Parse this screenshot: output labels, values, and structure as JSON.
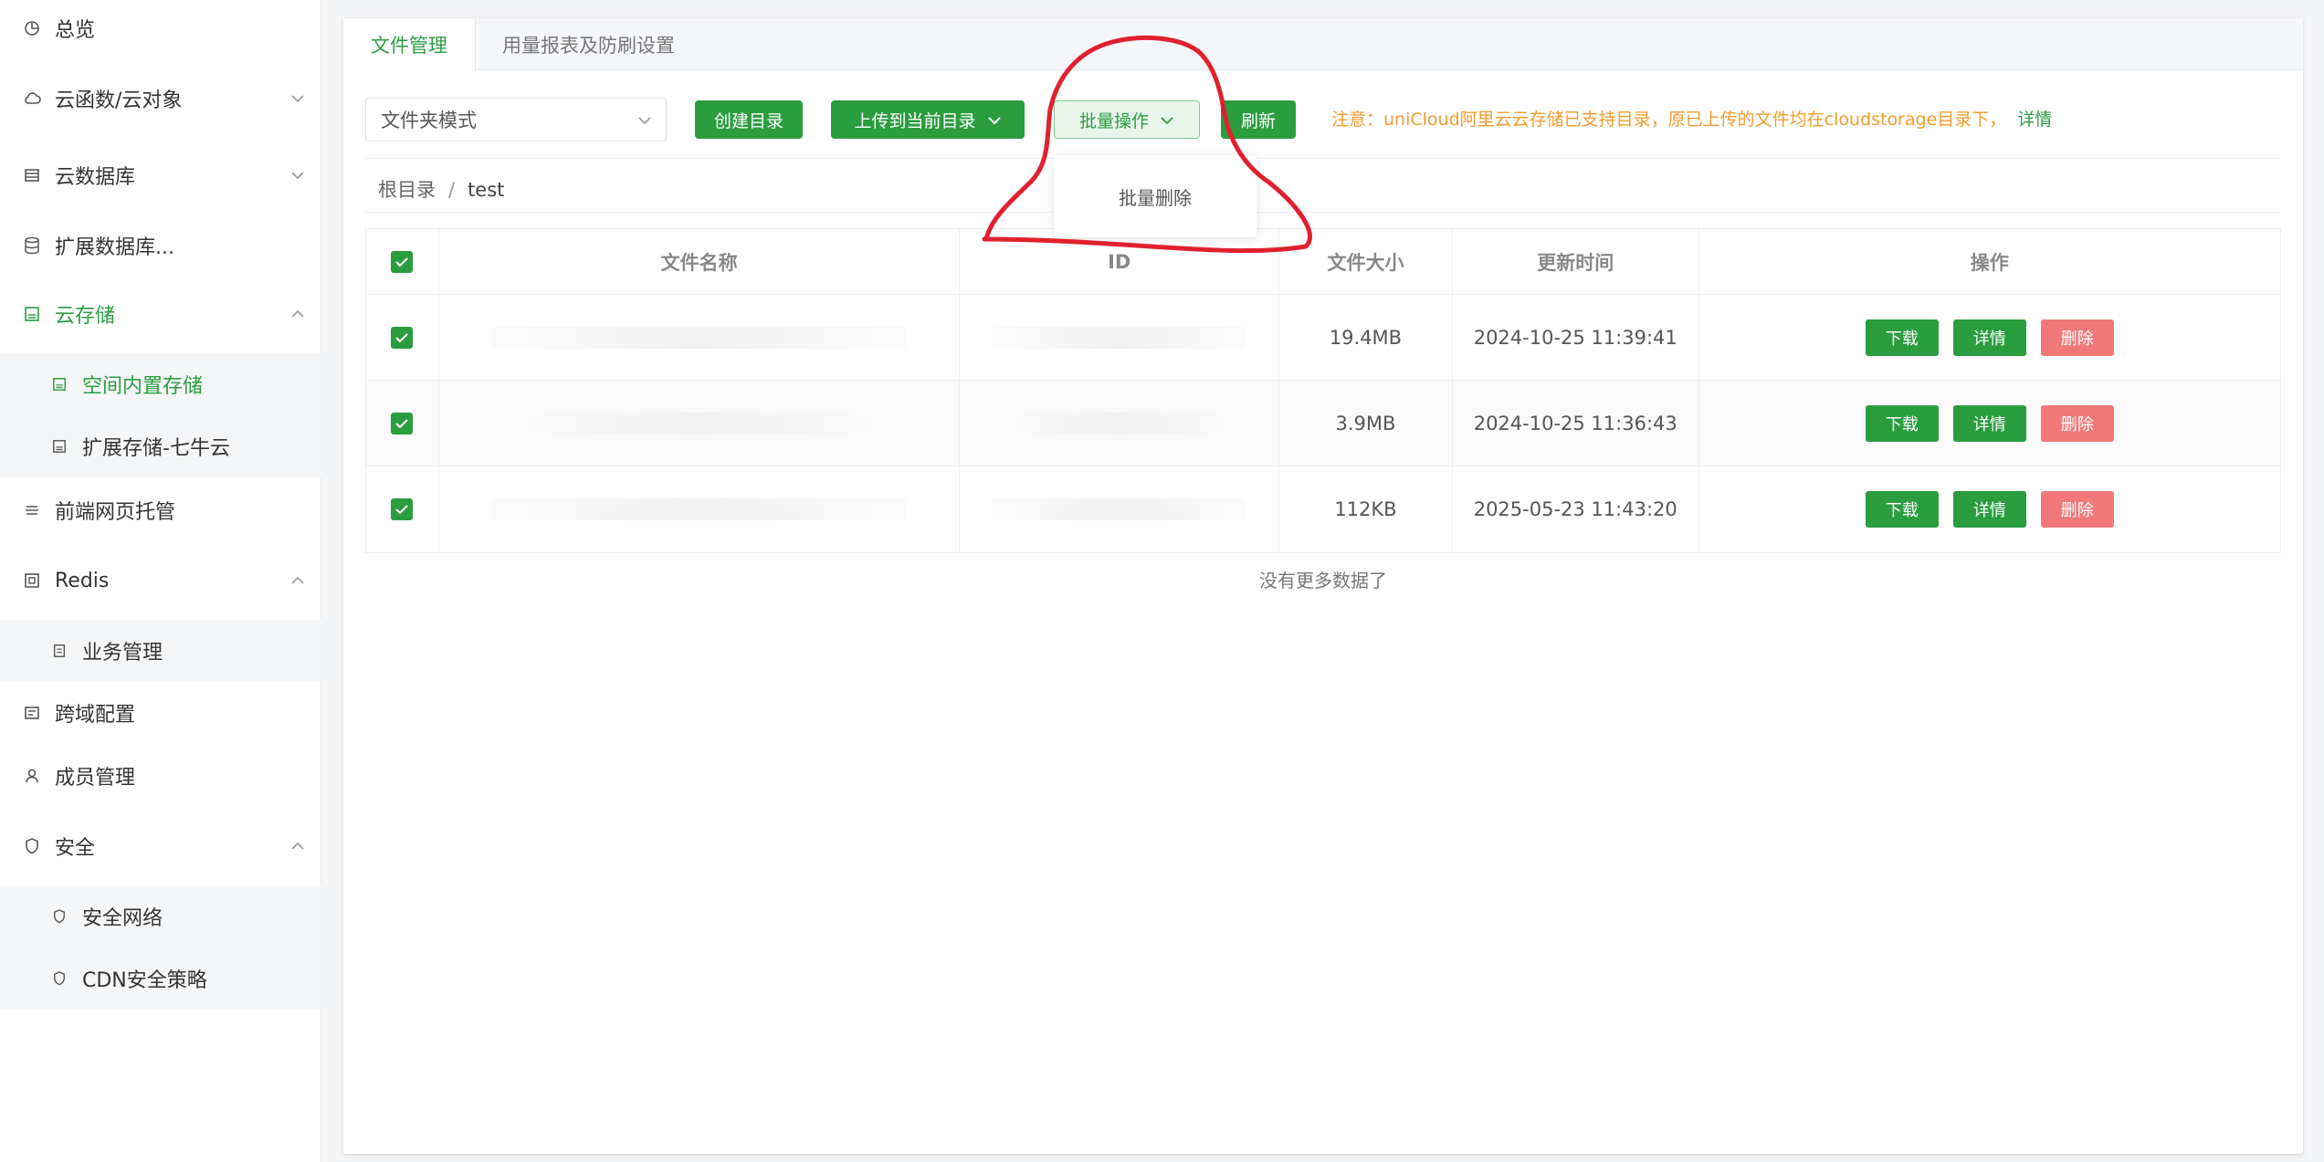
{
  "sidebar": {
    "items": [
      {
        "label": "总览",
        "icon": "pie-chart-icon",
        "chevron": ""
      },
      {
        "label": "云函数/云对象",
        "icon": "cloud-icon",
        "chevron": "down"
      },
      {
        "label": "云数据库",
        "icon": "database-icon",
        "chevron": "down"
      },
      {
        "label": "扩展数据库...",
        "icon": "database-stack-icon",
        "chevron": ""
      },
      {
        "label": "云存储",
        "icon": "storage-icon",
        "chevron": "up"
      },
      {
        "label": "空间内置存储",
        "icon": "storage-icon",
        "chevron": ""
      },
      {
        "label": "扩展存储-七牛云",
        "icon": "storage-icon",
        "chevron": ""
      },
      {
        "label": "前端网页托管",
        "icon": "hosting-icon",
        "chevron": ""
      },
      {
        "label": "Redis",
        "icon": "redis-icon",
        "chevron": "up"
      },
      {
        "label": "业务管理",
        "icon": "business-icon",
        "chevron": ""
      },
      {
        "label": "跨域配置",
        "icon": "cors-icon",
        "chevron": ""
      },
      {
        "label": "成员管理",
        "icon": "user-icon",
        "chevron": ""
      },
      {
        "label": "安全",
        "icon": "shield-icon",
        "chevron": "up"
      },
      {
        "label": "安全网络",
        "icon": "shield-icon",
        "chevron": ""
      },
      {
        "label": "CDN安全策略",
        "icon": "shield-icon",
        "chevron": ""
      }
    ]
  },
  "tabs": [
    "文件管理",
    "用量报表及防刷设置"
  ],
  "toolbar": {
    "mode_select": "文件夹模式",
    "create_dir": "创建目录",
    "upload": "上传到当前目录",
    "batch": "批量操作",
    "refresh": "刷新",
    "notice": "注意：uniCloud阿里云云存储已支持目录，原已上传的文件均在cloudstorage目录下，",
    "notice_link": "详情"
  },
  "dropdown": {
    "batch_delete": "批量删除"
  },
  "breadcrumb": {
    "root": "根目录",
    "sep": "/",
    "current": "test"
  },
  "table": {
    "headers": [
      "",
      "文件名称",
      "ID",
      "文件大小",
      "更新时间",
      "操作"
    ],
    "rows": [
      {
        "size": "19.4MB",
        "time": "2024-10-25 11:39:41"
      },
      {
        "size": "3.9MB",
        "time": "2024-10-25 11:36:43"
      },
      {
        "size": "112KB",
        "time": "2025-05-23 11:43:20"
      }
    ],
    "actions": {
      "download": "下载",
      "detail": "详情",
      "delete": "删除"
    }
  },
  "no_more": "没有更多数据了",
  "colors": {
    "accent": "#2a9d3f",
    "danger": "#f07878",
    "warning": "#f29b2c",
    "annotation": "#e0202f"
  }
}
